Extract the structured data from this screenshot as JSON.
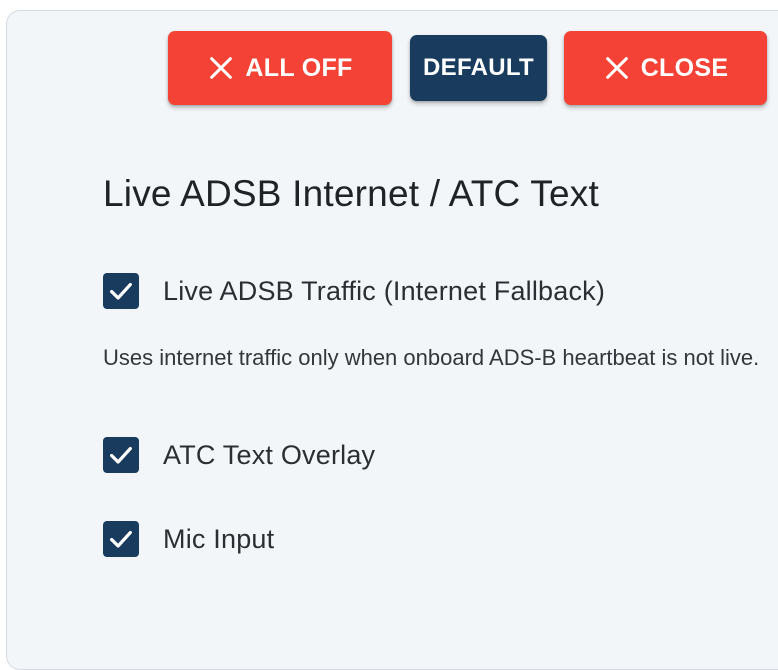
{
  "toolbar": {
    "all_off_label": "ALL OFF",
    "default_label": "DEFAULT",
    "close_label": "CLOSE"
  },
  "section": {
    "title": "Live ADSB Internet / ATC Text"
  },
  "options": [
    {
      "label": "Live ADSB Traffic (Internet Fallback)",
      "checked": true
    },
    {
      "label": "ATC Text Overlay",
      "checked": true
    },
    {
      "label": "Mic Input",
      "checked": true
    }
  ],
  "helper_text": "Uses internet traffic only when onboard ADS-B heartbeat is not live.",
  "colors": {
    "danger": "#f44336",
    "primary": "#183b5e",
    "panel_bg": "#f3f6f8"
  },
  "icons": {
    "all_off": "close-icon",
    "close": "close-icon",
    "checkbox": "checkmark-icon"
  }
}
